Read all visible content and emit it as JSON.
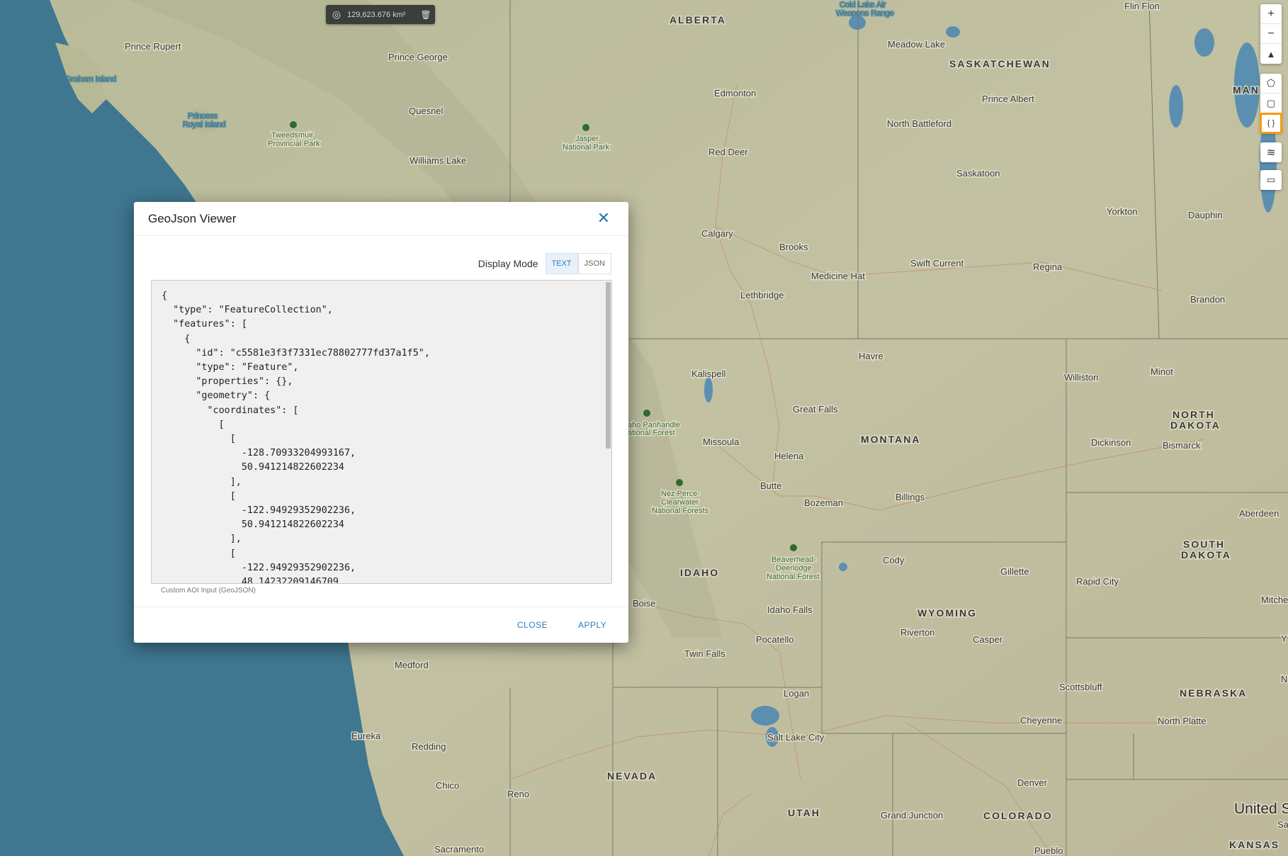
{
  "map": {
    "area_measure": "129,623.676 km²",
    "labels": {
      "states": [
        "ALBERTA",
        "SASKATCHEWAN",
        "MANI",
        "MONTANA",
        "NORTH",
        "DAKOTA",
        "SOUTH",
        "DAKOTA",
        "IDAHO",
        "WYOMING",
        "NEVADA",
        "UTAH",
        "COLORADO",
        "NEBRASKA",
        "KANSAS"
      ],
      "cities": [
        "Prince Rupert",
        "Prince George",
        "Quesnel",
        "Williams Lake",
        "Edmonton",
        "Red Deer",
        "Calgary",
        "Brooks",
        "Medicine Hat",
        "Lethbridge",
        "Meadow Lake",
        "Prince Albert",
        "North Battleford",
        "Saskatoon",
        "Swift Current",
        "Regina",
        "Yorkton",
        "Dauphin",
        "Brandon",
        "Flin Flon",
        "Havre",
        "Williston",
        "Minot",
        "Kalispell",
        "Great Falls",
        "Missoula",
        "Helena",
        "Butte",
        "Bozeman",
        "Billings",
        "Dickinson",
        "Bismarck",
        "Aberdeen",
        "Cody",
        "Gillette",
        "Rapid City",
        "Mitchell",
        "Boise",
        "Idaho Falls",
        "Riverton",
        "Casper",
        "Pocatello",
        "Twin Falls",
        "Medford",
        "Scottsbluff",
        "Logan",
        "Cheyenne",
        "North Platte",
        "Eureka",
        "Redding",
        "Salt Lake City",
        "Chico",
        "Reno",
        "Denver",
        "Grand Junction",
        "Sacramento",
        "Pueblo",
        "Sa",
        "Y",
        "N"
      ],
      "parks": [
        "Tweedsmuir",
        "Provincial Park",
        "Jasper",
        "National Park",
        "aho Panhandle",
        "ational Forest",
        "Nez Perce-",
        "Clearwater",
        "National Forests",
        "Beaverhead-",
        "Deerlodge",
        "National Forest"
      ],
      "water": [
        "Graham Island",
        "Princess",
        "Royal Island",
        "Cold Lake Air",
        "Weapons Range"
      ],
      "country": "United S"
    }
  },
  "toolbar": {
    "buttons": [
      "zoom-in-icon",
      "zoom-out-icon",
      "compass-icon",
      "polygon-icon",
      "rectangle-icon",
      "geojson-icon",
      "layers-icon",
      "ruler-icon"
    ],
    "zoom_in": "+",
    "zoom_out": "−",
    "geojson": "{ }",
    "active_color": "#f39c12"
  },
  "modal": {
    "title": "GeoJson Viewer",
    "display_mode_label": "Display Mode",
    "mode_text": "TEXT",
    "mode_json": "JSON",
    "active_mode": "TEXT",
    "code": "{\n  \"type\": \"FeatureCollection\",\n  \"features\": [\n    {\n      \"id\": \"c5581e3f3f7331ec78802777fd37a1f5\",\n      \"type\": \"Feature\",\n      \"properties\": {},\n      \"geometry\": {\n        \"coordinates\": [\n          [\n            [\n              -128.70933204993167,\n              50.941214822602234\n            ],\n            [\n              -122.94929352902236,\n              50.941214822602234\n            ],\n            [\n              -122.94929352902236,\n              48.14232209146709",
    "caption": "Custom AOI Input (GeoJSON)",
    "close_label": "CLOSE",
    "apply_label": "APPLY",
    "accent": "#2a7dbf"
  }
}
